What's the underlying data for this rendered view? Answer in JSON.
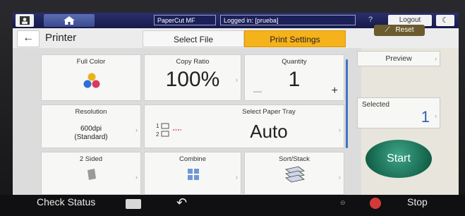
{
  "topbar": {
    "app_name": "PaperCut MF",
    "login_status": "Logged in: [prueba]",
    "help_symbol": "?",
    "logout_label": "Logout",
    "moon_symbol": "☾"
  },
  "header": {
    "title": "Printer",
    "tabs": [
      {
        "label": "Select File",
        "active": false
      },
      {
        "label": "Print Settings",
        "active": true
      }
    ]
  },
  "settings": {
    "full_color": {
      "label": "Full Color"
    },
    "copy_ratio": {
      "label": "Copy Ratio",
      "value": "100%"
    },
    "quantity": {
      "label": "Quantity",
      "value": "1",
      "minus": "—",
      "plus": "+"
    },
    "resolution": {
      "label": "Resolution",
      "value_line1": "600dpi",
      "value_line2": "(Standard)"
    },
    "paper_tray": {
      "label": "Select Paper Tray",
      "value": "Auto"
    },
    "two_sided": {
      "label": "2 Sided"
    },
    "combine": {
      "label": "Combine"
    },
    "sort_stack": {
      "label": "Sort/Stack"
    }
  },
  "right_panel": {
    "reset_label": "Reset",
    "preview_label": "Preview",
    "selected_label": "Selected",
    "selected_count": "1",
    "start_label": "Start"
  },
  "bottombar": {
    "check_status_label": "Check Status",
    "stop_label": "Stop"
  },
  "colors": {
    "active_tab": "#f6b21a",
    "topbar": "#1c2058",
    "start_button": "#16684f",
    "reset_button": "#6b5b2e",
    "scroll_indicator": "#3e74c7"
  }
}
